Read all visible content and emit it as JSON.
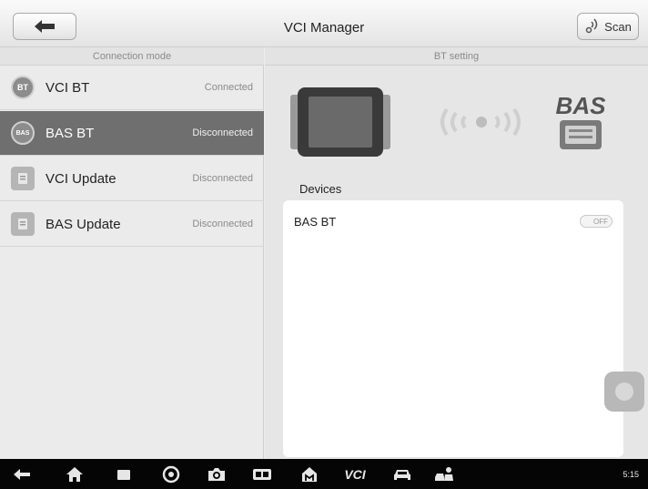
{
  "header": {
    "title": "VCI Manager",
    "scan_label": "Scan"
  },
  "columns": {
    "left": "Connection mode",
    "right": "BT setting"
  },
  "connections": [
    {
      "label": "VCI BT",
      "status": "Connected",
      "icon": "bt-icon",
      "icon_text": "BT",
      "selected": false
    },
    {
      "label": "BAS BT",
      "status": "Disconnected",
      "icon": "bas-icon",
      "icon_text": "BAS",
      "selected": true
    },
    {
      "label": "VCI Update",
      "status": "Disconnected",
      "icon": "update-icon",
      "icon_text": "",
      "selected": false
    },
    {
      "label": "BAS Update",
      "status": "Disconnected",
      "icon": "update-icon",
      "icon_text": "",
      "selected": false
    }
  ],
  "bt_setting": {
    "logo_text": "BAS",
    "devices_label": "Devices",
    "devices": [
      {
        "name": "BAS BT",
        "toggle": "OFF"
      }
    ]
  },
  "navbar": {
    "icons": [
      "back-icon",
      "home-icon",
      "recent-apps-icon",
      "browser-icon",
      "camera-icon",
      "screen-mirror-icon",
      "autel-home-icon",
      "vci-icon",
      "car-icon",
      "service-icon"
    ],
    "vci_text": "VCI",
    "status": "5:15"
  },
  "colors": {
    "selected_row": "#6f6f6f",
    "navbar": "#050505"
  }
}
